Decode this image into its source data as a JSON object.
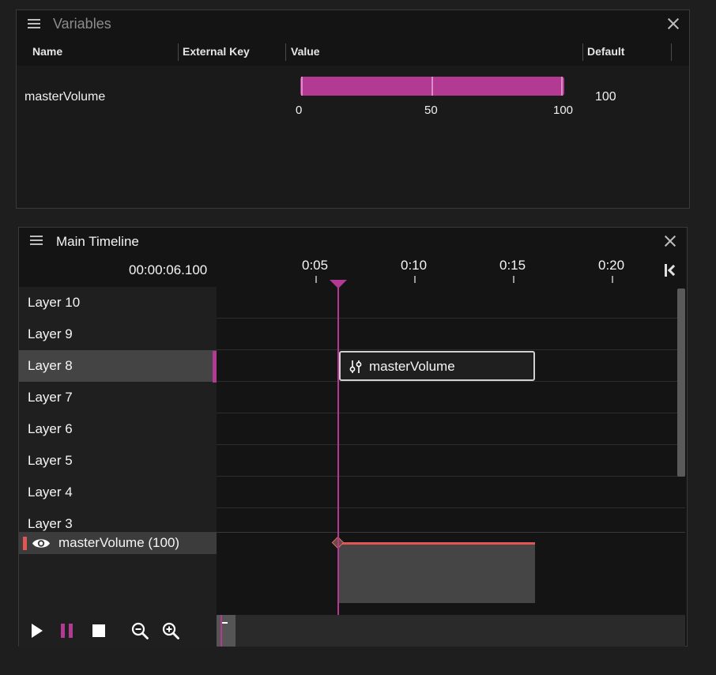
{
  "variables_panel": {
    "title": "Variables",
    "columns": {
      "name": "Name",
      "external_key": "External Key",
      "value": "Value",
      "default": "Default"
    },
    "rows": [
      {
        "name": "masterVolume",
        "value_fraction": 1.0,
        "slider_labels": [
          "0",
          "50",
          "100"
        ],
        "default": "100"
      }
    ],
    "accent_color": "#b23a93"
  },
  "timeline_panel": {
    "title": "Main Timeline",
    "timecode": "00:00:06.100",
    "ruler_ticks": [
      "0:05",
      "0:10",
      "0:15",
      "0:20"
    ],
    "layers": [
      "Layer 10",
      "Layer 9",
      "Layer 8",
      "Layer 7",
      "Layer 6",
      "Layer 5",
      "Layer 4",
      "Layer 3"
    ],
    "selected_layer": "Layer 8",
    "clip": {
      "label": "masterVolume",
      "icon": "sliders-icon"
    },
    "automation_track": {
      "label": "masterVolume (100)",
      "icon": "eye-icon",
      "color": "#e05555"
    },
    "controls": {
      "play": "play-icon",
      "pause": "pause-icon",
      "stop": "stop-icon",
      "zoom_out": "zoom-out-icon",
      "zoom_in": "zoom-in-icon",
      "go_to_start": "skip-to-start-icon"
    },
    "playhead_color": "#b23a93"
  }
}
